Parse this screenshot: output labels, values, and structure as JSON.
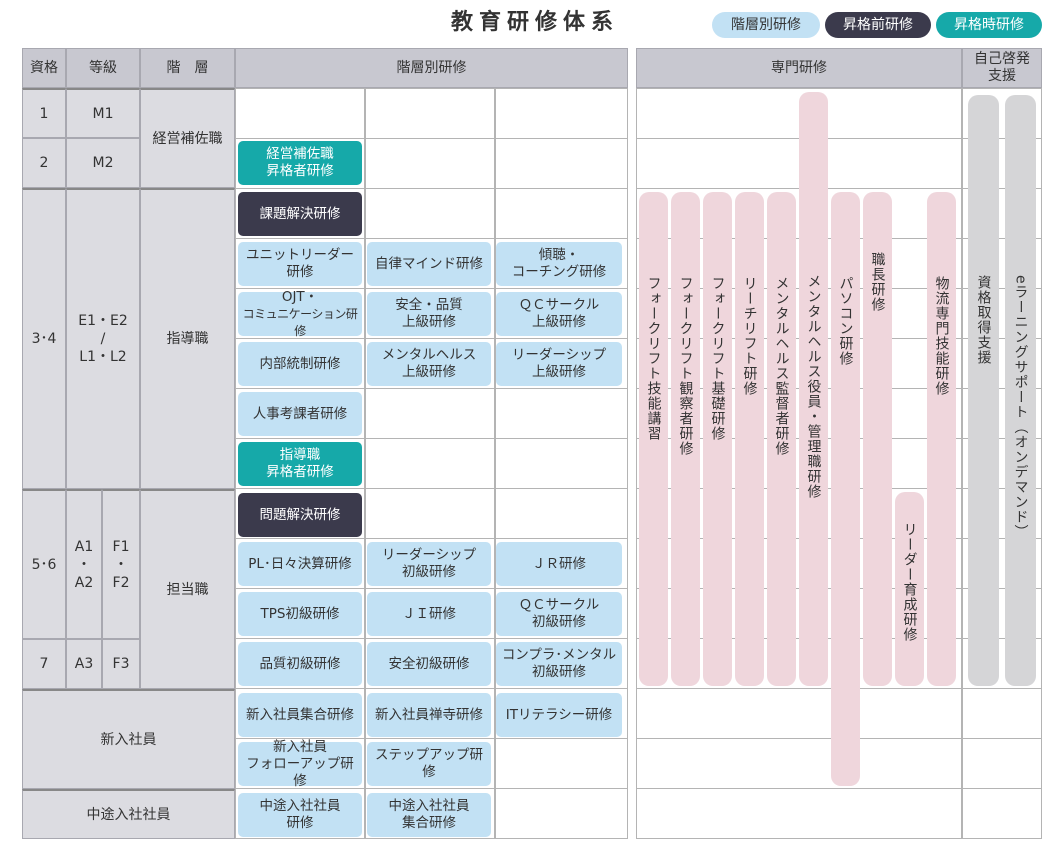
{
  "title": "教育研修体系",
  "legend": [
    "階層別研修",
    "昇格前研修",
    "昇格時研修"
  ],
  "colors": {
    "kaiso": "#c2e1f4",
    "shokaku_mae": "#3b3a4c",
    "shokaku_ji": "#16a9a9",
    "senmon": "#efd6dc",
    "jiko": "#d5d5d7"
  },
  "headers": {
    "shikaku": "資格",
    "tokyu": "等級",
    "kaiso": "階　層",
    "kaisobetsu": "階層別研修",
    "senmon": "専門研修",
    "jiko_line1": "自己啓発",
    "jiko_line2": "支援"
  },
  "rows": {
    "r1": {
      "shikaku": "1",
      "tokyu": "M1"
    },
    "r2": {
      "shikaku": "2",
      "tokyu": "M2"
    },
    "keiei": "経営補佐職",
    "r34": {
      "shikaku": "3･4",
      "tokyu_l1": "E1・E2",
      "tokyu_l2": "/",
      "tokyu_l3": "L1・L2"
    },
    "shido": "指導職",
    "r56": {
      "shikaku": "5･6",
      "a_l1": "A1",
      "a_l2": "・",
      "a_l3": "A2",
      "f_l1": "F1",
      "f_l2": "・",
      "f_l3": "F2"
    },
    "tanto": "担当職",
    "r7": {
      "shikaku": "7",
      "a": "A3",
      "f": "F3"
    },
    "shinnyu": "新入社員",
    "chuto": "中途入社社員"
  },
  "kaiso_boxes": {
    "keiei_shokaku_l1": "経営補佐職",
    "keiei_shokaku_l2": "昇格者研修",
    "kadai": "課題解決研修",
    "unit_l1": "ユニットリーダー",
    "unit_l2": "研修",
    "jiritsu": "自律マインド研修",
    "keicho_l1": "傾聴・",
    "keicho_l2": "コーチング研修",
    "ojt_l1": "OJT・",
    "ojt_l2": "コミュニケーション研修",
    "anzen_joukyu_l1": "安全・品質",
    "anzen_joukyu_l2": "上級研修",
    "qc_joukyu_l1": "ＱＣサークル",
    "qc_joukyu_l2": "上級研修",
    "naibu": "内部統制研修",
    "mental_joukyu_l1": "メンタルヘルス",
    "mental_joukyu_l2": "上級研修",
    "leader_joukyu_l1": "リーダーシップ",
    "leader_joukyu_l2": "上級研修",
    "jinji": "人事考課者研修",
    "shido_shokaku_l1": "指導職",
    "shido_shokaku_l2": "昇格者研修",
    "mondai": "問題解決研修",
    "pl": "PL･日々決算研修",
    "leader_shokyu_l1": "リーダーシップ",
    "leader_shokyu_l2": "初級研修",
    "jr": "ＪＲ研修",
    "tps": "TPS初級研修",
    "ji": "ＪＩ研修",
    "qc_shokyu_l1": "ＱＣサークル",
    "qc_shokyu_l2": "初級研修",
    "hinshitsu": "品質初級研修",
    "anzen_shokyu": "安全初級研修",
    "compla_l1": "コンプラ･メンタル",
    "compla_l2": "初級研修",
    "shinnyu_shugo": "新入社員集合研修",
    "shinnyu_zen": "新入社員禅寺研修",
    "it": "ITリテラシー研修",
    "follow_l1": "新入社員",
    "follow_l2": "フォローアップ研修",
    "step": "ステップアップ研修",
    "chuto_l1": "中途入社社員",
    "chuto_l2": "研修",
    "chuto_shugo_l1": "中途入社社員",
    "chuto_shugo_l2": "集合研修"
  },
  "senmon_bars": [
    "フォークリフト技能講習",
    "フォークリフト観察者研修",
    "フォークリフト基礎研修",
    "リーチリフト研修",
    "メンタルヘルス監督者研修",
    "メンタルヘルス役員・管理職研修",
    "パソコン研修",
    "職長研修",
    "リーダー育成研修",
    "物流専門技能研修"
  ],
  "jiko_bars": [
    "資格取得支援",
    "eラーニングサポート（オンデマンド）"
  ]
}
